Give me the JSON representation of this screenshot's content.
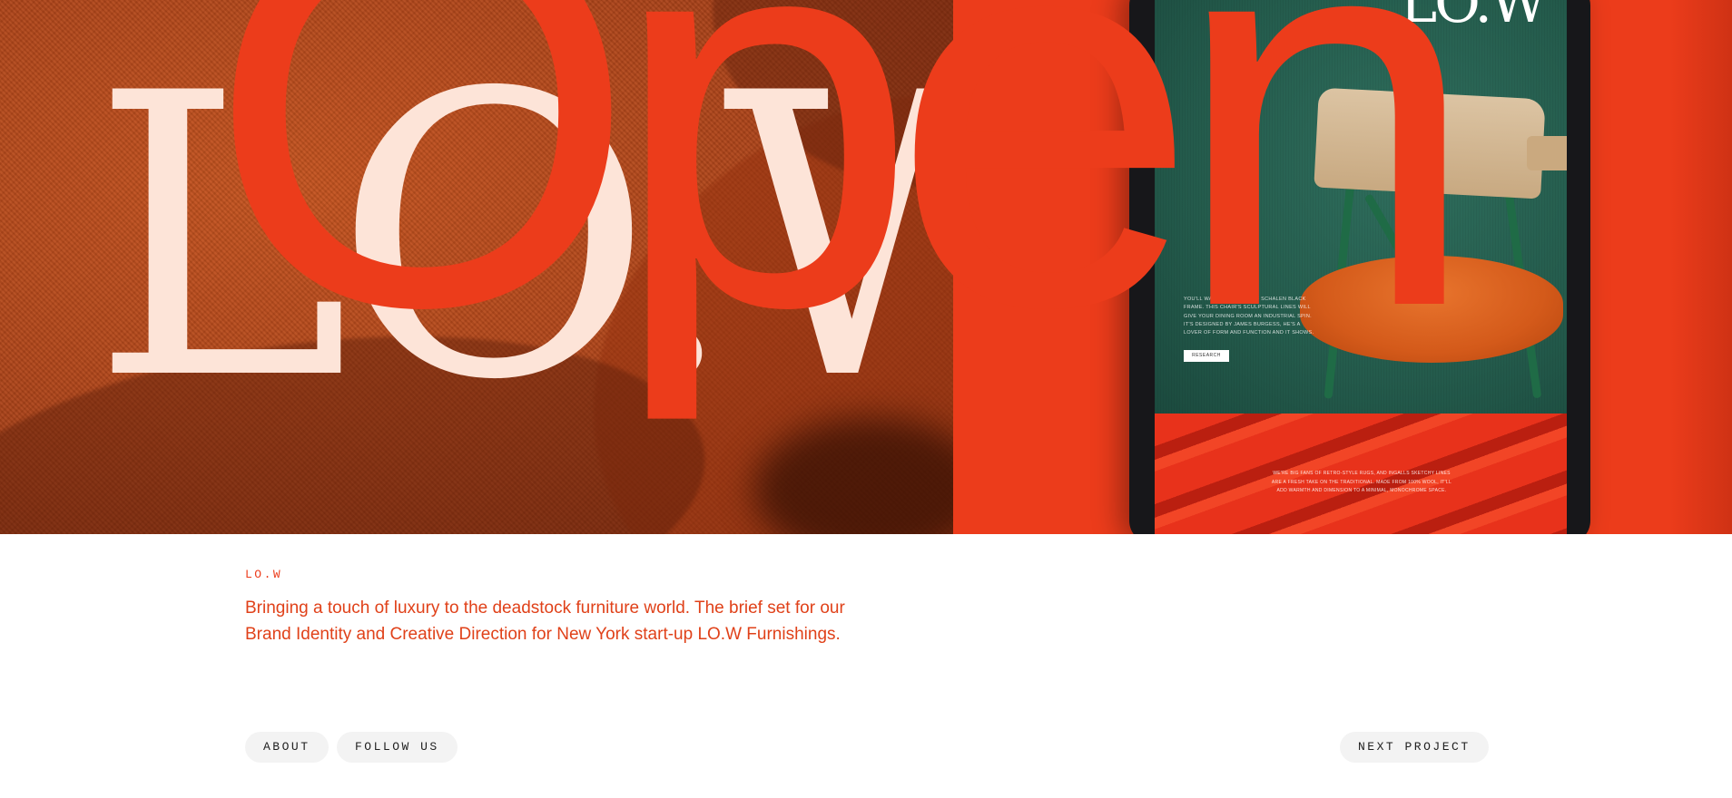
{
  "hero": {
    "logo_text": "LO.W",
    "overlay_word": "Open",
    "tablet": {
      "logo_text": "LO.W",
      "body_text": "YOU'LL WANT TO SHOW OFF SCHALEN BLACK FRAME. THIS CHAIR'S SCULPTURAL LINES WILL GIVE YOUR DINING ROOM AN INDUSTRIAL SPIN. IT'S DESIGNED BY JAMES BURGESS, HE'S A LOVER OF FORM AND FUNCTION AND IT SHOWS.",
      "button_label": "RESEARCH",
      "bottom_text": "WE'RE BIG FANS OF RETRO-STYLE RUGS, AND INGALLS SKETCHY LINES ARE A FRESH TAKE ON THE TRADITIONAL. MADE FROM 100% WOOL, IT'LL ADD WARMTH AND DIMENSION TO A MINIMAL, MONOCHROME SPACE."
    }
  },
  "project": {
    "label": "LO.W",
    "description": "Bringing a touch of luxury to the deadstock furniture world. The brief set for our Brand Identity and Creative Direction for New York start-up LO.W Furnishings."
  },
  "nav": {
    "about": "ABOUT",
    "follow": "FOLLOW US",
    "next": "NEXT PROJECT"
  },
  "colors": {
    "accent": "#ec3c1b",
    "logo": "#fde4d8",
    "pill_bg": "#f3f3f3",
    "tablet_screen": "#245b4c"
  }
}
